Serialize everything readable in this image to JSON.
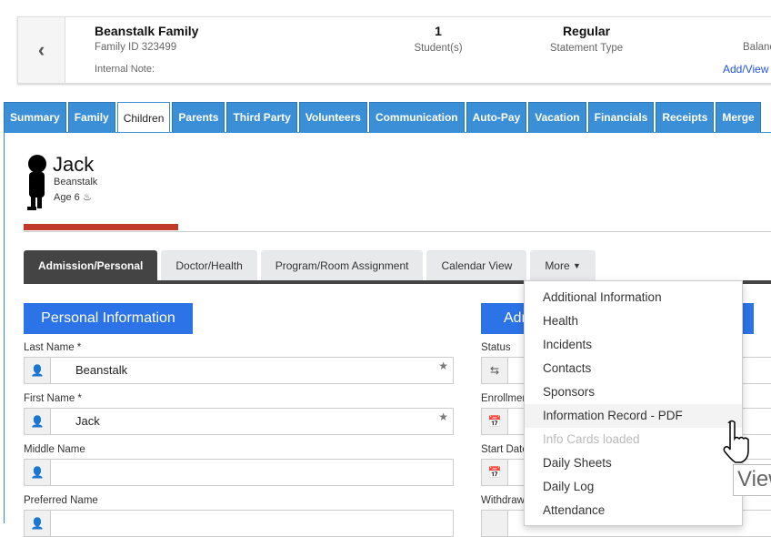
{
  "header": {
    "family_name": "Beanstalk Family",
    "family_id": "Family ID 323499",
    "internal_note": "Internal Note:",
    "students_value": "1",
    "students_label": "Student(s)",
    "statement_value": "Regular",
    "statement_label": "Statement Type",
    "balance_label": "Balance",
    "add_view_link": "Add/View"
  },
  "tabs": [
    "Summary",
    "Family",
    "Children",
    "Parents",
    "Third Party",
    "Volunteers",
    "Communication",
    "Auto-Pay",
    "Vacation",
    "Financials",
    "Receipts",
    "Merge"
  ],
  "active_tab": "Children",
  "child": {
    "first": "Jack",
    "last": "Beanstalk",
    "age": "Age 6"
  },
  "subtabs": [
    "Admission/Personal",
    "Doctor/Health",
    "Program/Room Assignment",
    "Calendar View",
    "More"
  ],
  "personal": {
    "title": "Personal Information",
    "fields": [
      {
        "label": "Last Name *",
        "value": "Beanstalk"
      },
      {
        "label": "First Name *",
        "value": "Jack"
      },
      {
        "label": "Middle Name",
        "value": ""
      },
      {
        "label": "Preferred Name",
        "value": ""
      }
    ]
  },
  "admission": {
    "title": "Admission Information",
    "fields": [
      "Status",
      "Enrollment Date",
      "Start Date",
      "Withdraw Date"
    ]
  },
  "more_menu": [
    "Additional Information",
    "Health",
    "Incidents",
    "Contacts",
    "Sponsors",
    "Information Record - PDF",
    "Info Cards loaded",
    "Daily Sheets",
    "Daily Log",
    "Attendance"
  ],
  "hovered_item": "Information Record - PDF",
  "disabled_item": "Info Cards loaded",
  "tooltip": "View",
  "colors": {
    "tab_blue": "#3a8fd6",
    "section_blue": "#2b73e6",
    "progress_red": "#c0392b",
    "link": "#2255dd"
  }
}
